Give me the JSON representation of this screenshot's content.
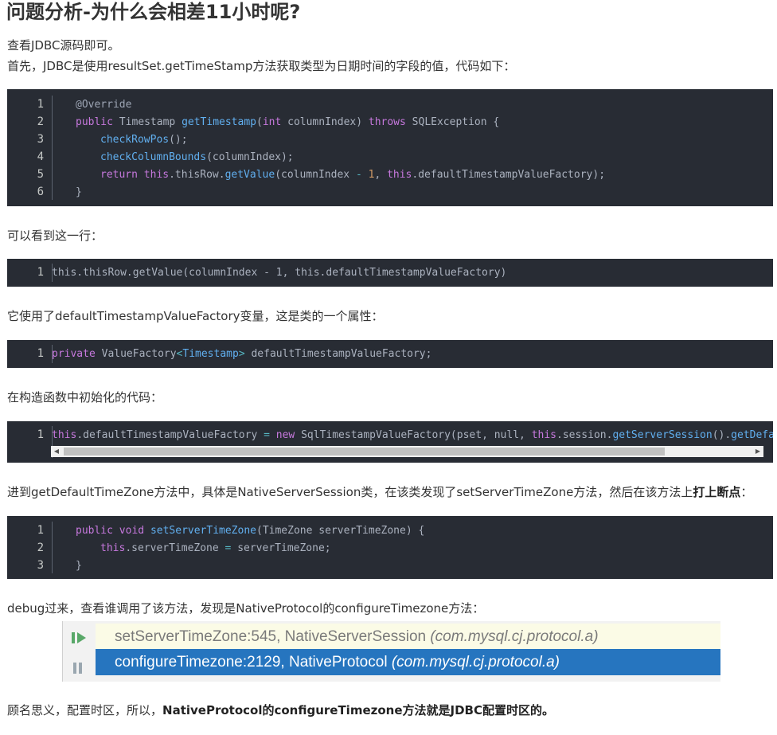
{
  "heading": "问题分析-为什么会相差11小时呢?",
  "intro": {
    "line1": "查看JDBC源码即可。",
    "line2": "首先，JDBC是使用resultSet.getTimeStamp方法获取类型为日期时间的字段的值，代码如下："
  },
  "block1": {
    "line_numbers": [
      "1",
      "2",
      "3",
      "4",
      "5",
      "6"
    ],
    "l1_annotation": "@Override",
    "l2": {
      "kw_public": "public",
      "type": " Timestamp ",
      "fn": "getTimestamp",
      "p1": "(",
      "kw_int": "int",
      "p2": " columnIndex) ",
      "kw_throws": "throws",
      "p3": " SQLException {"
    },
    "l3": {
      "fn": "checkRowPos",
      "rest": "();"
    },
    "l4": {
      "fn": "checkColumnBounds",
      "rest": "(columnIndex);"
    },
    "l5": {
      "kw_return": "return",
      "sp": " ",
      "kw_this": "this",
      "a": ".thisRow.",
      "fn": "getValue",
      "b": "(columnIndex ",
      "op": "-",
      "c": " ",
      "num": "1",
      "d": ", ",
      "kw_this2": "this",
      "e": ".defaultTimestampValueFactory);"
    },
    "l6": "}"
  },
  "text2": "可以看到这一行：",
  "block2": {
    "line_numbers": [
      "1"
    ],
    "code": "this.thisRow.getValue(columnIndex - 1, this.defaultTimestampValueFactory)"
  },
  "text3": "它使用了defaultTimestampValueFactory变量，这是类的一个属性：",
  "block3": {
    "line_numbers": [
      "1"
    ],
    "kw_private": "private",
    "a": " ValueFactory",
    "lt": "<",
    "tag": "Timestamp",
    "gt": ">",
    "b": " defaultTimestampValueFactory;"
  },
  "text4": "在构造函数中初始化的代码：",
  "block4": {
    "line_numbers": [
      "1"
    ],
    "kw_this": "this",
    "a": ".defaultTimestampValueFactory ",
    "op": "=",
    "b": " ",
    "kw_new": "new",
    "c": " SqlTimestampValueFactory(pset, null, ",
    "kw_this2": "this",
    "d": ".session.",
    "fn": "getServerSession",
    "e": "().",
    "fn2": "getDefa",
    "scroll_left": "◀",
    "scroll_right": "▶"
  },
  "text5": {
    "plain": "进到getDefaultTimeZone方法中，具体是NativeServerSession类，在该类发现了setServerTimeZone方法，然后在该方法上",
    "bold": "打上断点",
    "end": "："
  },
  "block5": {
    "line_numbers": [
      "1",
      "2",
      "3"
    ],
    "l1": {
      "kw_public": "public",
      "sp": " ",
      "kw_void": "void",
      "sp2": " ",
      "fn": "setServerTimeZone",
      "rest": "(TimeZone serverTimeZone) {"
    },
    "l2": {
      "kw_this": "this",
      "a": ".serverTimeZone ",
      "op": "=",
      "b": " serverTimeZone;"
    },
    "l3": "}"
  },
  "text6": "debug过来，查看谁调用了该方法，发现是NativeProtocol的configureTimezone方法：",
  "debug": {
    "frames": [
      {
        "method": "setServerTimeZone:545, NativeServerSession ",
        "pkg": "(com.mysql.cj.protocol.a)"
      },
      {
        "method": "configureTimezone:2129, NativeProtocol ",
        "pkg": "(com.mysql.cj.protocol.a)"
      }
    ],
    "colors": {
      "resume": "#59a869",
      "pause": "#9aa7b0",
      "selected_bg": "#2675bf",
      "frame_bg": "#fbfbe6"
    }
  },
  "text7": {
    "plain": "顾名思义，配置时区，所以，",
    "bold": "NativeProtocol的configureTimezone方法就是JDBC配置时区的。"
  }
}
